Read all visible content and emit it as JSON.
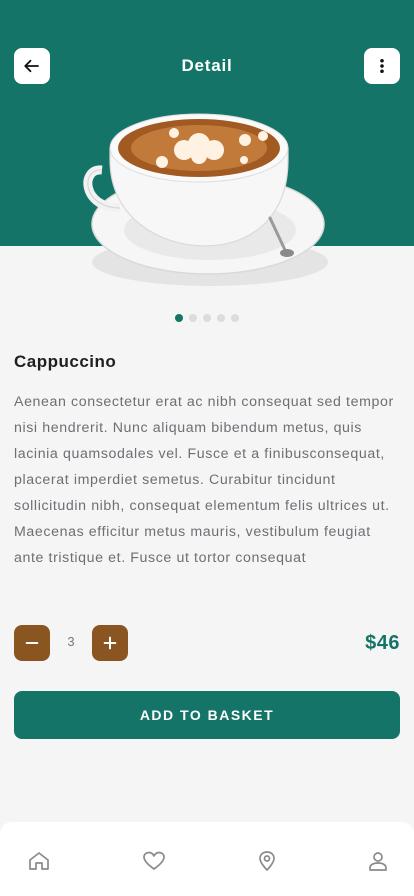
{
  "header": {
    "title": "Detail",
    "background_color": "#147468",
    "back_icon": "arrow-left-icon",
    "more_icon": "more-vertical-icon"
  },
  "product": {
    "image": "cappuccino-cup-image",
    "name": "Cappuccino",
    "description": "Aenean consectetur erat ac nibh consequat sed tempor nisi hendrerit. Nunc aliquam bibendum metus, quis lacinia quamsodales vel. Fusce et a finibusconsequat, placerat imperdiet semetus. Curabitur tincidunt sollicitudin nibh, consequat elementum felis ultrices ut. Maecenas efficitur metus mauris, vestibulum feugiat ante tristique et. Fusce ut tortor consequat",
    "price": "$46"
  },
  "carousel": {
    "total": 5,
    "active_index": 0
  },
  "quantity": {
    "value": "3",
    "minus_icon": "minus-icon",
    "plus_icon": "plus-icon",
    "button_color": "#8a5520"
  },
  "actions": {
    "add_to_basket": "ADD TO BASKET"
  },
  "bottom_nav": {
    "items": [
      {
        "icon": "home-icon"
      },
      {
        "icon": "heart-icon"
      },
      {
        "icon": "location-pin-icon"
      },
      {
        "icon": "user-icon"
      }
    ]
  }
}
